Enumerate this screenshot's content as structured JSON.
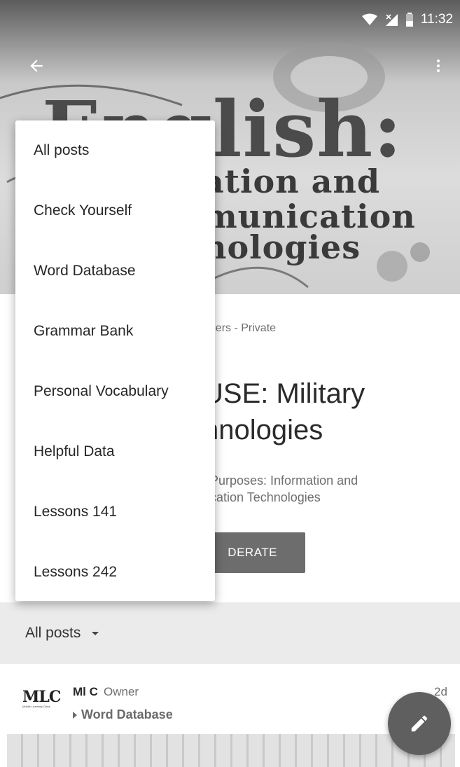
{
  "status_bar": {
    "time": "11:32",
    "icons": [
      "wifi-icon",
      "signal-icon",
      "battery-icon"
    ]
  },
  "toolbar": {
    "back_icon": "arrow-back-icon",
    "more_icon": "more-vert-icon"
  },
  "banner": {
    "title_line_1": "English:",
    "title_line_2": "ation and",
    "title_line_3": "munication",
    "title_line_4": "nologies"
  },
  "group": {
    "members_text": "nbers - Private",
    "title": "USE: Military\nnnologies",
    "description": "Purposes: Information and\ncation Technologies",
    "moderate_label": "DERATE"
  },
  "dropdown": {
    "items": [
      "All posts",
      "Check Yourself",
      "Word Database",
      "Grammar Bank",
      "Personal Vocabulary",
      "Helpful Data",
      "Lessons 141",
      "Lessons 242"
    ]
  },
  "filter": {
    "label": "All posts"
  },
  "post": {
    "logo_text": "MLC",
    "logo_subtext": "Mobile Learning Class",
    "author": "Ml C",
    "role": "Owner",
    "category": "Word Database",
    "time": "2d"
  },
  "fab": {
    "icon": "pencil-icon"
  },
  "colors": {
    "menu_background": "#ffffff",
    "button_gray": "#6d6d6d",
    "fab_gray": "#5f5f5f",
    "filter_bar": "#ebebeb"
  }
}
